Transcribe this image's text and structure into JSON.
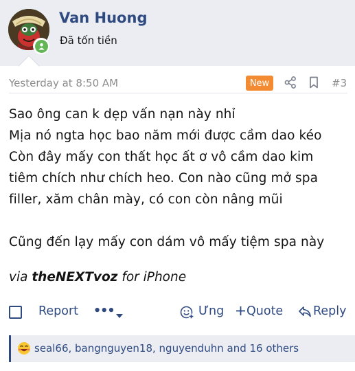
{
  "user": {
    "name": "Van Huong",
    "title": "Đã tốn tiền"
  },
  "post": {
    "time": "Yesterday at 8:50 AM",
    "badge": "New",
    "number": "#3",
    "lines": [
      "Sao ông can k dẹp vấn nạn này nhỉ",
      "Mịa nó ngta học bao năm mới được cầm dao kéo",
      "Còn đây mấy con thất học ất ơ vô cầm dao kim",
      "tiêm chích như chích heo. Con nào cũng mở spa",
      "filler, xăm chân mày, có con còn nâng mũi",
      "",
      "Cũng đến lạy mấy con dám vô mấy tiệm spa này"
    ],
    "signature_via": "via",
    "signature_app": "theNEXTvoz",
    "signature_device": "for iPhone"
  },
  "actions": {
    "report": "Report",
    "more": "•••",
    "react": "Ưng",
    "quote": "Quote",
    "reply": "Reply"
  },
  "reactions": {
    "text": "seal66, bangnguyen18, nguyenduhn and 16 others"
  },
  "colors": {
    "accent": "#2f4a80",
    "badge": "#f28b31",
    "online": "#63b656",
    "header_bg": "#ebedf3"
  },
  "icons": [
    "share-icon",
    "bookmark-icon",
    "chevron-down-icon",
    "smile-plus-icon",
    "plus-icon",
    "reply-icon",
    "laugh-emoji-icon",
    "user-online-icon"
  ]
}
